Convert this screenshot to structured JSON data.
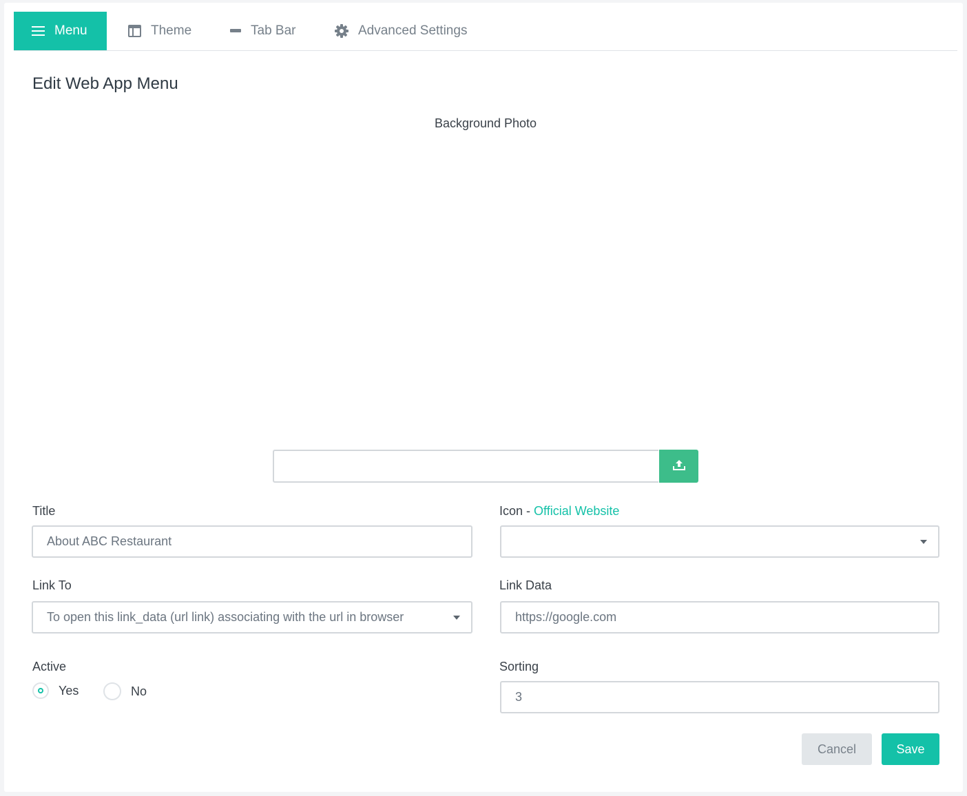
{
  "tabs": [
    {
      "label": "Menu",
      "icon": "hamburger-icon",
      "active": true
    },
    {
      "label": "Theme",
      "icon": "layout-icon",
      "active": false
    },
    {
      "label": "Tab Bar",
      "icon": "minus-icon",
      "active": false
    },
    {
      "label": "Advanced Settings",
      "icon": "gear-icon",
      "active": false
    }
  ],
  "page_title": "Edit Web App Menu",
  "background_photo": {
    "label": "Background Photo",
    "file_value": "",
    "upload_icon": "upload-icon"
  },
  "title_field": {
    "label": "Title",
    "value": "About ABC Restaurant"
  },
  "icon_field": {
    "label": "Icon",
    "separator": " - ",
    "link_text": "Official Website",
    "value": ""
  },
  "link_to_field": {
    "label": "Link To",
    "value": "To open this link_data (url link) associating with the url in browser"
  },
  "link_data_field": {
    "label": "Link Data",
    "value": "https://google.com"
  },
  "active_field": {
    "label": "Active",
    "options": [
      {
        "label": "Yes",
        "selected": true
      },
      {
        "label": "No",
        "selected": false
      }
    ]
  },
  "sorting_field": {
    "label": "Sorting",
    "value": "3"
  },
  "buttons": {
    "cancel": "Cancel",
    "save": "Save"
  },
  "colors": {
    "accent": "#14c1a8",
    "upload": "#3dbd8a",
    "cancel_bg": "#e2e6e9"
  }
}
